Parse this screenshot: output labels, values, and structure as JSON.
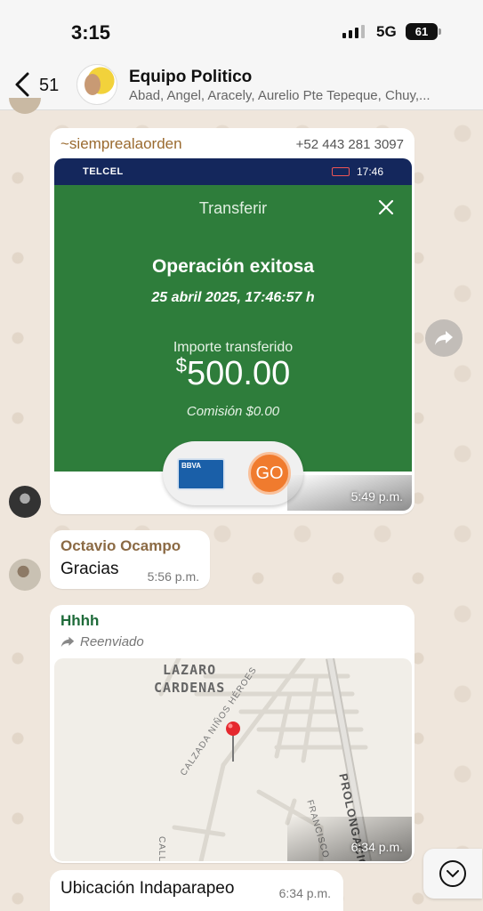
{
  "status": {
    "time": "3:15",
    "network": "5G",
    "battery": "61"
  },
  "header": {
    "back_count": "51",
    "title": "Equipo Politico",
    "members": "Abad, Angel, Aracely, Aurelio Pte Tepeque, Chuy,..."
  },
  "messages": [
    {
      "sender": "~siemprealaorden",
      "phone": "+52 443 281 3097",
      "image": {
        "carrier": "TELCEL",
        "phone_time": "17:46",
        "screen_title": "Transferir",
        "result": "Operación exitosa",
        "datetime": "25 abril 2025, 17:46:57 h",
        "amount_label": "Importe transferido",
        "amount_currency": "$",
        "amount_value": "500.00",
        "commission": "Comisión  $0.00",
        "card_brand": "BBVA",
        "go_label": "GO"
      },
      "time": "5:49 p.m."
    },
    {
      "sender": "Octavio Ocampo",
      "text": "Gracias",
      "time": "5:56 p.m."
    },
    {
      "sender": "Hhhh",
      "forwarded_label": "Reenviado",
      "map": {
        "area_line1": "LAZARO",
        "area_line2": "CARDENAS",
        "street1": "CALZADA NIÑOS HÉROES",
        "street2": "PROLONGACIÓ",
        "street3": "FRANCISCO J.",
        "street4": "CALL"
      },
      "time": "6:34 p.m."
    },
    {
      "text": "Ubicación Indaparapeo",
      "time": "6:34 p.m."
    }
  ],
  "colors": {
    "transfer_green": "#2e7d3b",
    "phone_bar": "#14275c",
    "go_orange": "#f07b2e"
  },
  "icons": {
    "back": "chevron-left-icon",
    "forward": "share-forward-icon",
    "scroll": "chevron-down-circle-icon",
    "map_pin": "map-pin-icon"
  }
}
